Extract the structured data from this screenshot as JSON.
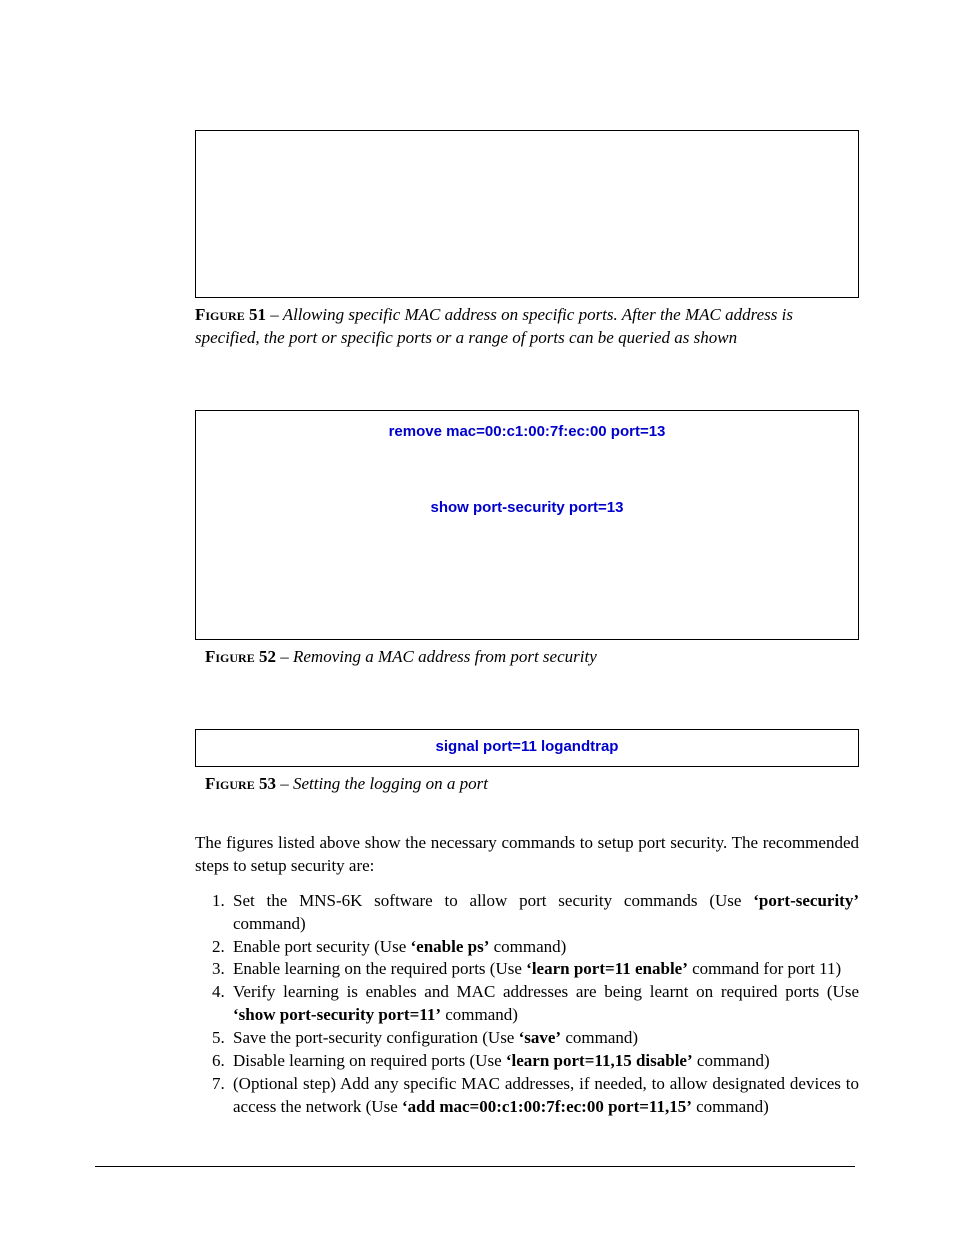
{
  "fig51": {
    "label": "Figure 51",
    "sep": " – ",
    "text": "Allowing specific MAC address on specific ports. After the MAC address is specified, the port or specific ports or a range of ports can be queried as shown"
  },
  "fig52": {
    "cmd1": "remove mac=00:c1:00:7f:ec:00 port=13",
    "cmd2": "show port-security port=13",
    "label": "Figure 52",
    "sep": " – ",
    "text": "Removing a MAC address from port security"
  },
  "fig53": {
    "cmd": "signal port=11 logandtrap",
    "label": "Figure 53",
    "sep": " – ",
    "text": "Setting the logging on a port"
  },
  "para": "The figures listed above show the necessary commands to setup port security. The recommended steps to setup security are:",
  "steps": {
    "s1a": "Set the MNS-6K software to allow port security commands (Use ",
    "s1b": "'port-security'",
    "s1c": " command)",
    "s2a": "Enable port security (Use ",
    "s2b": "'enable ps'",
    "s2c": " command)",
    "s3a": "Enable learning on the required ports (Use ",
    "s3b": "'learn  port=11 enable'",
    "s3c": " command for port 11)",
    "s4a": "Verify learning is enables and MAC addresses are being learnt on required ports (Use ",
    "s4b": "'show port-security port=11'",
    "s4c": " command)",
    "s5a": "Save the port-security configuration (Use ",
    "s5b": "'save'",
    "s5c": " command)",
    "s6a": "Disable learning on required ports (Use ",
    "s6b": "'learn port=11,15 disable'",
    "s6c": " command)",
    "s7a": "(Optional step) Add any specific MAC addresses, if needed, to allow designated devices to access the network (Use ",
    "s7b": "'add mac=00:c1:00:7f:ec:00 port=11,15'",
    "s7c": " command)"
  }
}
